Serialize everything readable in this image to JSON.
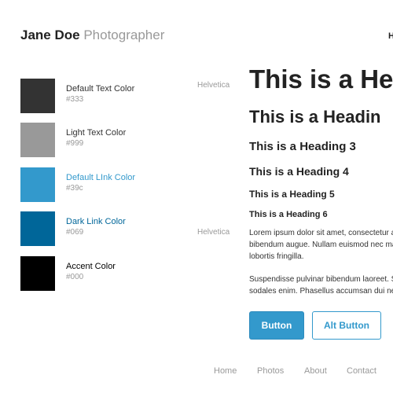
{
  "header": {
    "name": "Jane Doe",
    "role": "Photographer",
    "nav_cut": "H"
  },
  "colors": [
    {
      "name": "Default Text Color",
      "code": "#333",
      "hex": "#333333"
    },
    {
      "name": "Light Text Color",
      "code": "#999",
      "hex": "#999999"
    },
    {
      "name": "Default LInk Color",
      "code": "#39c",
      "hex": "#3399cc"
    },
    {
      "name": "Dark Link Color",
      "code": "#069",
      "hex": "#006699"
    },
    {
      "name": "Accent Color",
      "code": "#000",
      "hex": "#000000"
    }
  ],
  "fonts": {
    "heading_font": "Helvetica",
    "body_font": "Helvetica"
  },
  "headings": {
    "h1": "This is a He",
    "h2": "This is a Headin",
    "h3": "This is a Heading 3",
    "h4": "This is a Heading 4",
    "h5": "This is a Heading 5",
    "h6": "This is a Heading 6"
  },
  "paragraphs": [
    [
      "Lorem ipsum dolor sit amet, consectetur a",
      "bibendum augue. Nullam euismod nec ma",
      "lobortis fringilla."
    ],
    [
      "Suspendisse pulvinar bibendum laoreet. S",
      "sodales enim. Phasellus accumsan dui ne"
    ]
  ],
  "buttons": {
    "primary": "Button",
    "alt": "Alt Button"
  },
  "footer_nav": [
    "Home",
    "Photos",
    "About",
    "Contact"
  ]
}
